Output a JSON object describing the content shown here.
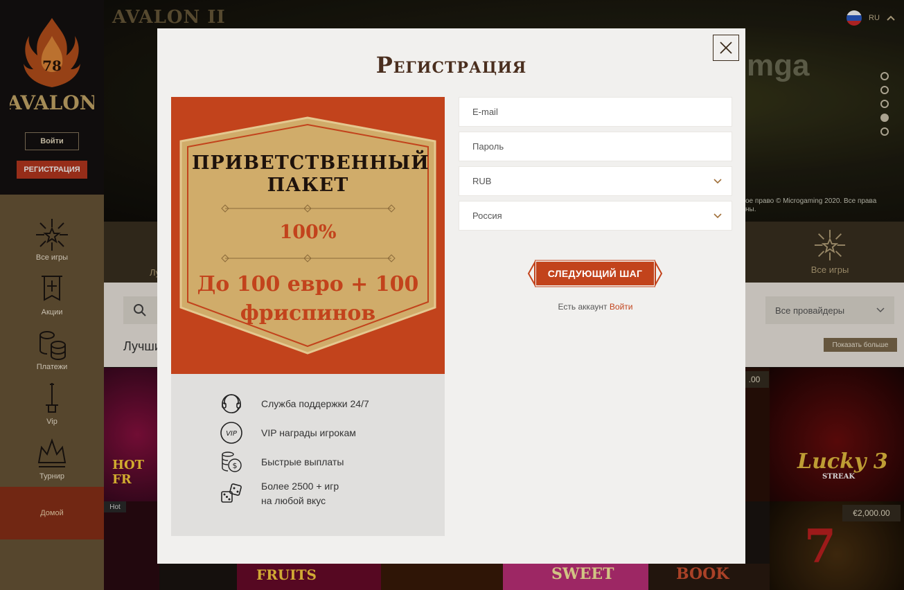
{
  "background": {
    "sidebar": {
      "login_label": "Войти",
      "register_label": "РЕГИСТРАЦИЯ",
      "logo_number": "78",
      "logo_text": "AVALON",
      "nav": [
        {
          "label": "Все игры",
          "icon": "fireworks-icon"
        },
        {
          "label": "Акции",
          "icon": "banner-icon"
        },
        {
          "label": "Платежи",
          "icon": "coins-icon"
        },
        {
          "label": "Vip",
          "icon": "sword-icon"
        },
        {
          "label": "Турнир",
          "icon": "crown-icon"
        }
      ],
      "home_label": "Домой"
    },
    "hero": {
      "logo_text": "AVALON II",
      "partner_text": "mga",
      "copyright": "ое право © Microgaming 2020. Все права ны.",
      "language": "RU",
      "slides_total": 5,
      "active_slide": 4
    },
    "categories": {
      "all_games_label": "Все игры",
      "partial_label": "Лу"
    },
    "filter": {
      "search_placeholder": "",
      "provider_label": "Все провайдеры",
      "section_title": "Лучши",
      "show_more_label": "Показать больше"
    },
    "tiles": {
      "hot_badge": "Hot",
      "price_badge_1": ".00",
      "price_badge_2": "€2,000.00",
      "tile_1_text": "HOT FR",
      "tile_2_text": "Lucky 3",
      "tile_2_sub": "STREAK",
      "tile_3_text": "FRUITS",
      "tile_4_text": "SWEET",
      "tile_5_text": "BOOK"
    }
  },
  "modal": {
    "title": "Регистрация",
    "promo": {
      "title": "ПРИВЕТСТВЕННЫЙ ПАКЕТ",
      "percent": "100%",
      "bonus": "До 100 евро + 100 фриспинов"
    },
    "features": [
      {
        "icon": "support-headset-icon",
        "text": "Служба поддержки 24/7"
      },
      {
        "icon": "vip-badge-icon",
        "text": "VIP награды игрокам"
      },
      {
        "icon": "coins-stack-icon",
        "text": "Быстрые выплаты"
      },
      {
        "icon": "dice-icon",
        "text_line1": "Более 2500 + игр",
        "text_line2": "на любой вкус"
      }
    ],
    "form": {
      "email_placeholder": "E-mail",
      "password_placeholder": "Пароль",
      "currency_value": "RUB",
      "country_value": "Россия"
    },
    "next_label": "СЛЕДУЮЩИЙ ШАГ",
    "have_account_text": "Есть аккаунт",
    "login_link": "Войти"
  },
  "colors": {
    "accent": "#c2431c",
    "title": "#4a2e1e",
    "promo_gold": "#d0ac6a",
    "modal_bg": "#f1f0ee"
  }
}
